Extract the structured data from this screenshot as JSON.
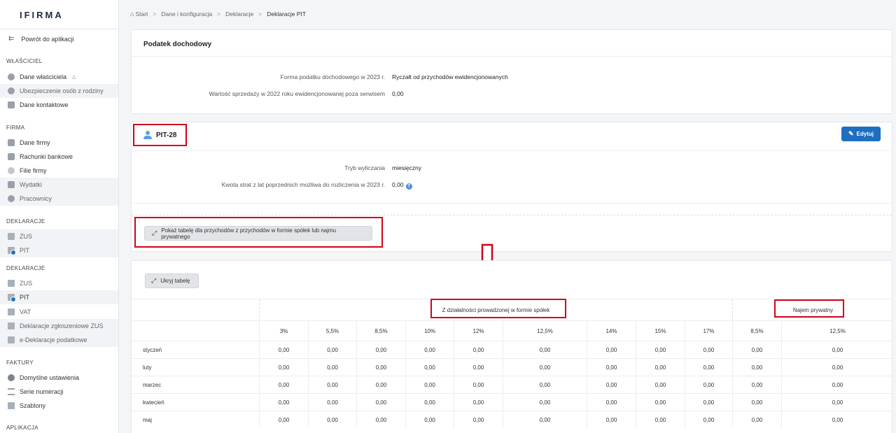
{
  "logo": {
    "text": "IFIRMA"
  },
  "sidebar": {
    "back": "Powrót do aplikacji",
    "sections": [
      {
        "title": "WŁAŚCICIEL",
        "items": [
          "Dane właściciela",
          "Ubezpieczenie osób z rodziny",
          "Dane kontaktowe"
        ]
      },
      {
        "title": "FIRMA",
        "items": [
          "Dane firmy",
          "Rachunki bankowe",
          "Filie firmy",
          "Wydatki",
          "Pracownicy"
        ]
      },
      {
        "title": "DEKLARACJE",
        "items": [
          "ZUS",
          "PIT"
        ]
      },
      {
        "title": "DEKLARACJE",
        "items": [
          "ZUS",
          "PIT",
          "VAT",
          "Deklaracje zgłoszeniowe ZUS",
          "e-Deklaracje podatkowe"
        ]
      },
      {
        "title": "FAKTURY",
        "items": [
          "Domyślne ustawienia",
          "Serie numeracji",
          "Szablony"
        ]
      },
      {
        "title": "APLIKACJA",
        "items": []
      }
    ],
    "warn_symbol": "⚠"
  },
  "breadcrumb": [
    "Start",
    "Dane i konfiguracja",
    "Deklaracje",
    "Deklaracje PIT"
  ],
  "income_tax": {
    "title": "Podatek dochodowy",
    "rows": [
      {
        "label": "Forma podatku dochodowego w 2023 r.",
        "value": "Ryczałt od przychodów ewidencjonowanych"
      },
      {
        "label": "Wartość sprzedaży w 2022 roku ewidencjonowanej poza serwisem",
        "value": "0,00"
      }
    ]
  },
  "pit28": {
    "title": "PIT-28",
    "edit_label": "Edytuj",
    "rows": [
      {
        "label": "Tryb wyliczania",
        "value": "miesięczny"
      },
      {
        "label": "Kwota strat z lat poprzednich możliwa do rozliczenia w 2023 r.",
        "value": "0,00"
      }
    ],
    "info_symbol": "?",
    "show_table_label": "Pokaż tabelę dla przychodów z przychodów w formie spółek lub najmu prywatnego"
  },
  "table": {
    "hide_label": "Ukryj tabelę",
    "group_spolki": "Z działalności prowadzonej w formie spółek",
    "group_najem": "Najem prywatny",
    "rates": [
      "3%",
      "5,5%",
      "8,5%",
      "10%",
      "12%",
      "12,5%",
      "14%",
      "15%",
      "17%",
      "8,5%",
      "12,5%"
    ],
    "months": [
      {
        "name": "styczeń",
        "values": [
          "0,00",
          "0,00",
          "0,00",
          "0,00",
          "0,00",
          "0,00",
          "0,00",
          "0,00",
          "0,00",
          "0,00",
          "0,00"
        ]
      },
      {
        "name": "luty",
        "values": [
          "0,00",
          "0,00",
          "0,00",
          "0,00",
          "0,00",
          "0,00",
          "0,00",
          "0,00",
          "0,00",
          "0,00",
          "0,00"
        ]
      },
      {
        "name": "marzec",
        "values": [
          "0,00",
          "0,00",
          "0,00",
          "0,00",
          "0,00",
          "0,00",
          "0,00",
          "0,00",
          "0,00",
          "0,00",
          "0,00"
        ]
      },
      {
        "name": "kwiecień",
        "values": [
          "0,00",
          "0,00",
          "0,00",
          "0,00",
          "0,00",
          "0,00",
          "0,00",
          "0,00",
          "0,00",
          "0,00",
          "0,00"
        ]
      },
      {
        "name": "maj",
        "values": [
          "0,00",
          "0,00",
          "0,00",
          "0,00",
          "0,00",
          "0,00",
          "0,00",
          "0,00",
          "0,00",
          "0,00",
          "0,00"
        ]
      }
    ]
  },
  "colors": {
    "accent": "#1e6fc0",
    "highlight": "#d0021b"
  }
}
